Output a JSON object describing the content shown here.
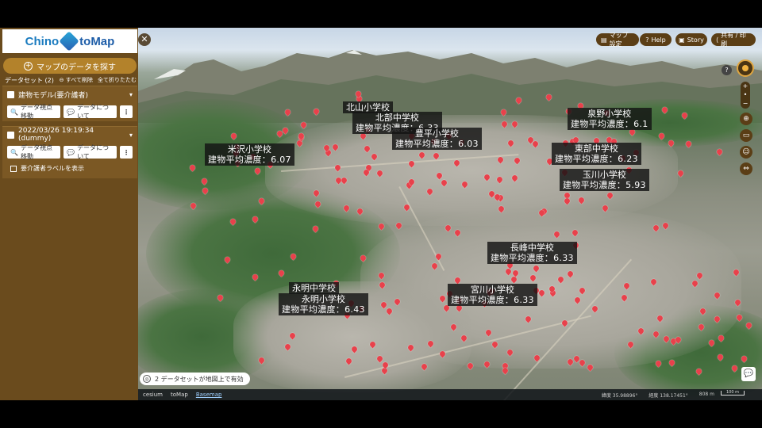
{
  "app": {
    "logo": {
      "part1": "Chino",
      "part2": "toMap",
      "logo_icon": "hexagon-logo-icon"
    }
  },
  "sidebar": {
    "explore_button": "マップのデータを探す",
    "datasets_title": "データセット (2)",
    "remove_all": "すべて削除",
    "collapse_all": "全て折りたたむ",
    "cards": [
      {
        "title": "建物モデル(要介護者)",
        "buttons": {
          "view": "データ視点移動",
          "about": "データについて"
        }
      },
      {
        "title": "2022/03/26 19:19:34 (dummy)",
        "buttons": {
          "view": "データ視点移動",
          "about": "データについて"
        },
        "checkbox_label": "要介護者ラベルを表示"
      }
    ]
  },
  "toolbar": {
    "map_settings": "マップ設定",
    "help": "Help",
    "story": "Story",
    "share": "共有 / 印刷"
  },
  "map": {
    "labels": [
      {
        "name": "北山小学校",
        "value": ""
      },
      {
        "name": "北部中学校",
        "value": "建物平均濃度：6.33"
      },
      {
        "name": "豊平小学校",
        "value": "建物平均濃度：6.03"
      },
      {
        "name": "泉野小学校",
        "value": "建物平均濃度：6.1"
      },
      {
        "name": "米沢小学校",
        "value": "建物平均濃度：6.07"
      },
      {
        "name": "東部中学校",
        "value": "建物平均濃度：6.23"
      },
      {
        "name": "玉川小学校",
        "value": "建物平均濃度：5.93"
      },
      {
        "name": "長峰中学校",
        "value": "建物平均濃度：6.33"
      },
      {
        "name": "永明中学校",
        "value": ""
      },
      {
        "name": "永明小学校",
        "value": "建物平均濃度：6.43"
      },
      {
        "name": "宮川小学校",
        "value": "建物平均濃度：6.33"
      }
    ],
    "status_pill": "2 データセットが地図上で有効",
    "bottom_bar": {
      "credit": "cesium",
      "brand": "toMap",
      "basemap": "Basemap",
      "lat_label": "緯度",
      "lat": "35.98896°",
      "lon_label": "経度",
      "lon": "138.17451°",
      "elev": "808 m",
      "scale": "100 m"
    }
  },
  "colors": {
    "sidebar": "#6a4b1d",
    "accent": "#b3822b",
    "pin": "#e8414b"
  }
}
